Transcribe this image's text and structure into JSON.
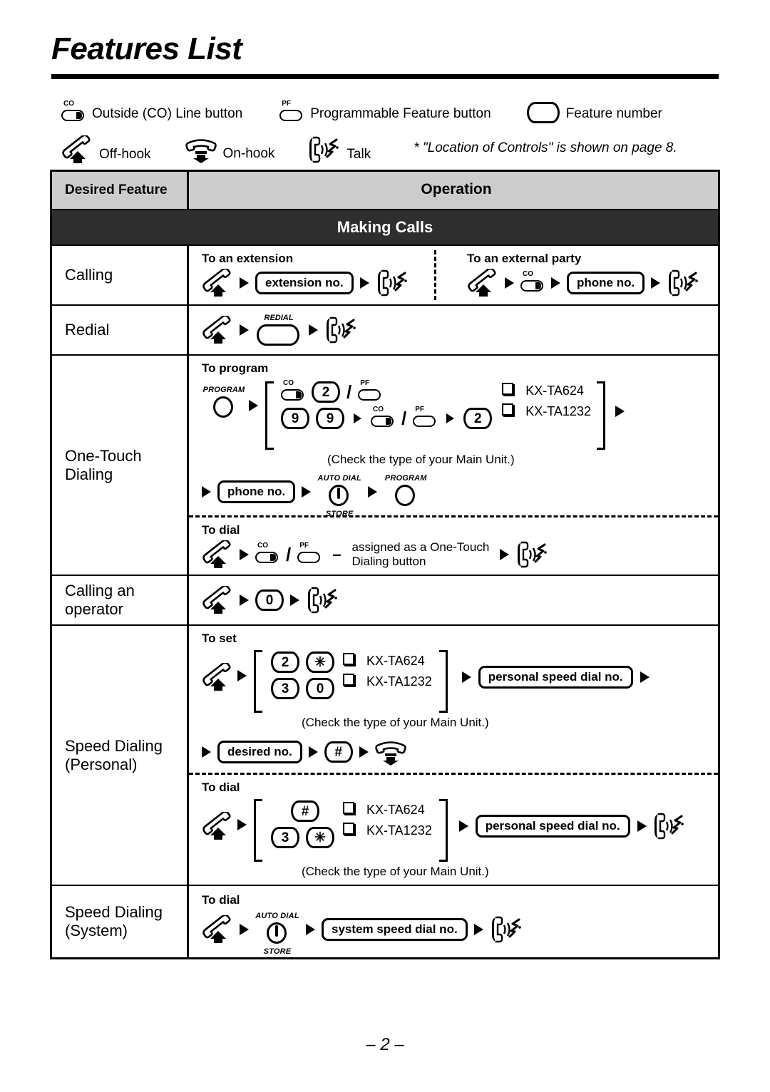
{
  "page": {
    "title": "Features List",
    "footer": "– 2 –"
  },
  "legend": {
    "items": [
      {
        "icon": "co-line-button-icon",
        "tag": "CO",
        "label": "Outside (CO) Line button"
      },
      {
        "icon": "pf-button-icon",
        "tag": "PF",
        "label": "Programmable Feature button"
      },
      {
        "icon": "feature-number-box-icon",
        "label": "Feature number"
      },
      {
        "icon": "off-hook-icon",
        "label": "Off-hook"
      },
      {
        "icon": "on-hook-icon",
        "label": "On-hook"
      },
      {
        "icon": "talk-icon",
        "label": "Talk"
      }
    ],
    "note": "* \"Location of Controls\" is shown on page 8."
  },
  "table": {
    "headers": {
      "feature": "Desired Feature",
      "operation": "Operation"
    },
    "section_title": "Making Calls",
    "rows": [
      {
        "feature": "Calling",
        "left_sublabel": "To an extension",
        "right_sublabel": "To an external party",
        "left_pill": "extension no.",
        "right_pill": "phone no."
      },
      {
        "feature": "Redial",
        "button_label": "REDIAL"
      },
      {
        "feature": "One-Touch Dialing",
        "feature_line1": "One-Touch",
        "feature_line2": "Dialing",
        "program_sublabel": "To program",
        "program_button_label": "PROGRAM",
        "key_2": "2",
        "key_9a": "9",
        "key_9b": "9",
        "key_2b": "2",
        "unit_a": "KX-TA624",
        "unit_b": "KX-TA1232",
        "check_note": "(Check the type of your Main Unit.)",
        "phone_pill": "phone no.",
        "autodial_top": "AUTO DIAL",
        "autodial_bottom": "STORE",
        "program_label2": "PROGRAM",
        "dial_sublabel": "To dial",
        "assigned_line1": "assigned as a One-Touch",
        "assigned_line2": "Dialing button"
      },
      {
        "feature": "Calling an operator",
        "feature_line1": "Calling an",
        "feature_line2": "operator",
        "key_0": "0"
      },
      {
        "feature": "Speed Dialing (Personal)",
        "feature_line1": "Speed Dialing",
        "feature_line2": "(Personal)",
        "set_sublabel": "To set",
        "set_key_a1": "2",
        "set_key_a2": "✳",
        "set_key_b1": "3",
        "set_key_b2": "0",
        "unit_a": "KX-TA624",
        "unit_b": "KX-TA1232",
        "check_note": "(Check the type of your Main Unit.)",
        "personal_pill": "personal speed dial no.",
        "desired_pill": "desired no.",
        "hash_key": "#",
        "dial_sublabel": "To dial",
        "dial_key_a1": "#",
        "dial_key_b1": "3",
        "dial_key_b2": "✳"
      },
      {
        "feature": "Speed Dialing (System)",
        "feature_line1": "Speed Dialing",
        "feature_line2": "(System)",
        "dial_sublabel": "To dial",
        "autodial_top": "AUTO DIAL",
        "autodial_bottom": "STORE",
        "system_pill": "system speed dial no."
      }
    ]
  },
  "colors": {
    "header_bg": "#cccccc",
    "section_bg": "#2e2e2e",
    "section_fg": "#ffffff",
    "ink": "#000000"
  }
}
